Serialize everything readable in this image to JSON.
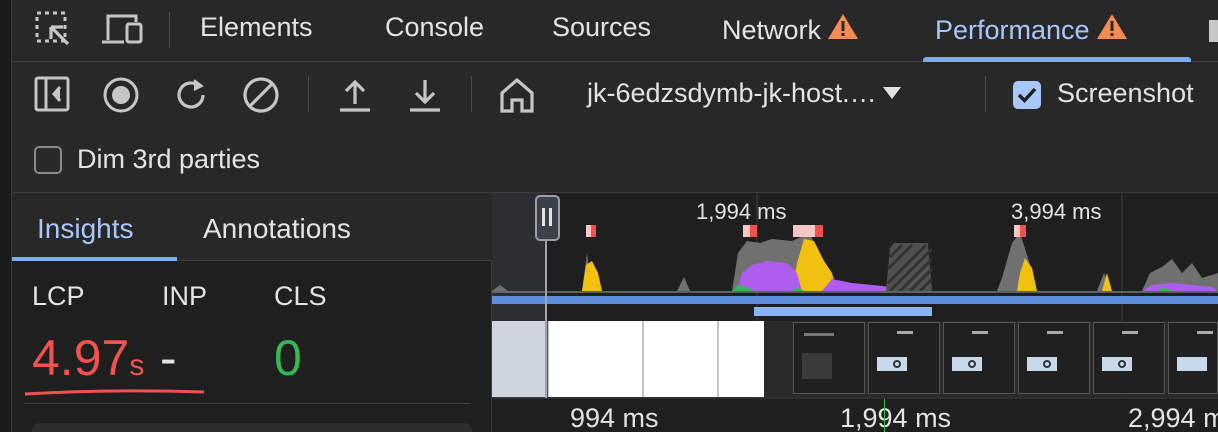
{
  "tabs": {
    "items": [
      {
        "label": "Elements",
        "active": false,
        "warning": false
      },
      {
        "label": "Console",
        "active": false,
        "warning": false
      },
      {
        "label": "Sources",
        "active": false,
        "warning": false
      },
      {
        "label": "Network",
        "active": false,
        "warning": true
      },
      {
        "label": "Performance",
        "active": true,
        "warning": true
      }
    ],
    "icons": [
      "inspect-element-icon",
      "device-toolbar-icon"
    ]
  },
  "toolbar": {
    "icons": [
      "sidebar-toggle-icon",
      "record-icon",
      "reload-record-icon",
      "clear-icon",
      "upload-icon",
      "download-icon",
      "home-icon"
    ],
    "url_selector": "jk-6edzsdymb-jk-host.…",
    "screenshots_label": "Screenshot",
    "screenshots_checked": true,
    "dim_label": "Dim 3rd parties",
    "dim_checked": false
  },
  "sidebar": {
    "tabs": [
      {
        "label": "Insights",
        "active": true
      },
      {
        "label": "Annotations",
        "active": false
      }
    ],
    "metrics": {
      "lcp_label": "LCP",
      "lcp_value": "4.97",
      "lcp_unit": "s",
      "inp_label": "INP",
      "inp_value": "-",
      "cls_label": "CLS",
      "cls_value": "0"
    }
  },
  "timeline": {
    "overview_ticks": [
      "1,994 ms",
      "3,994 ms"
    ],
    "ruler_ticks": [
      "994 ms",
      "1,994 ms",
      "2,994 ms"
    ]
  },
  "colors": {
    "accent": "#a8c7fa",
    "lcp_poor": "#f0524f",
    "cls_good": "#34b955",
    "warning": "#f28b54",
    "scripting": "#f2c010",
    "rendering": "#af5cf0",
    "painting": "#34b955",
    "system": "#707070"
  }
}
